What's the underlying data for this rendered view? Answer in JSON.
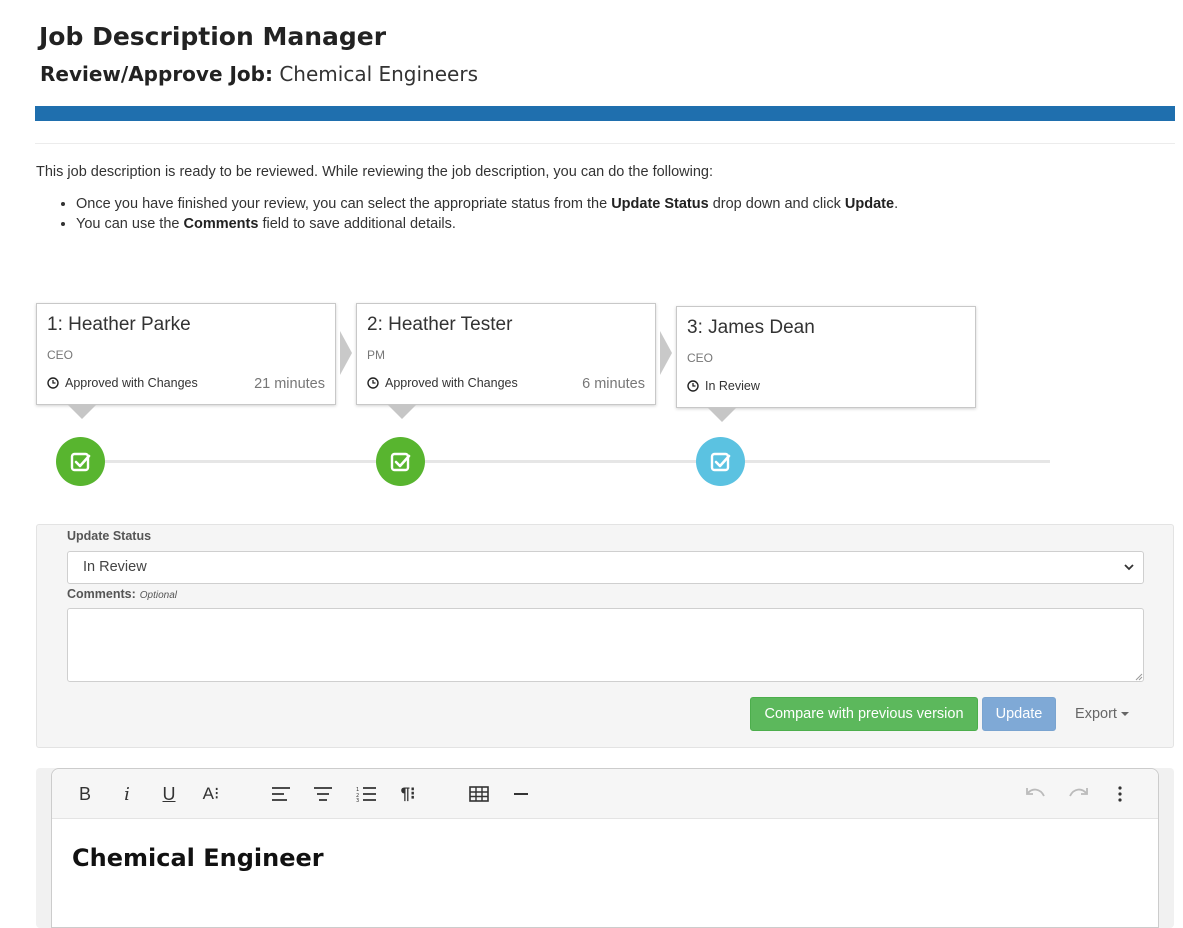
{
  "app": {
    "title": "Job Description Manager",
    "subtitle_prefix": "Review/Approve Job:",
    "subtitle_job": "Chemical Engineers"
  },
  "intro": {
    "text": "This job description is ready to be reviewed. While reviewing the job description, you can do the following:",
    "bullet1": {
      "a": "Once you have finished your review, you can select the appropriate status from the ",
      "b1": "Update Status",
      "c": " drop down and click ",
      "b2": "Update",
      "d": "."
    },
    "bullet2": {
      "a": "You can use the ",
      "b1": "Comments",
      "c": " field to save additional details."
    }
  },
  "approvers": [
    {
      "name": "1: Heather Parke",
      "role": "CEO",
      "status": "Approved with Changes",
      "time": "21 minutes",
      "state": "approved"
    },
    {
      "name": "2: Heather Tester",
      "role": "PM",
      "status": "Approved with Changes",
      "time": "6 minutes",
      "state": "approved"
    },
    {
      "name": "3: James Dean",
      "role": "CEO",
      "status": "In Review",
      "time": "",
      "state": "in-review"
    }
  ],
  "colors": {
    "brand_bar": "#1f6fae",
    "approved": "#58b52f",
    "in_review": "#5bc2e1",
    "compare_button": "#5cb85c",
    "update_button": "#7fa9d6"
  },
  "form": {
    "status_label": "Update Status",
    "status_value": "In Review",
    "comments_label": "Comments:",
    "comments_optional": "Optional",
    "comments_value": ""
  },
  "buttons": {
    "compare": "Compare with previous version",
    "update": "Update",
    "export": "Export"
  },
  "toolbar": {
    "bold": "B",
    "italic": "i",
    "underline": "U",
    "font_size": "A⁝",
    "paragraph_format": "¶⁝"
  },
  "editor": {
    "heading": "Chemical Engineer"
  }
}
